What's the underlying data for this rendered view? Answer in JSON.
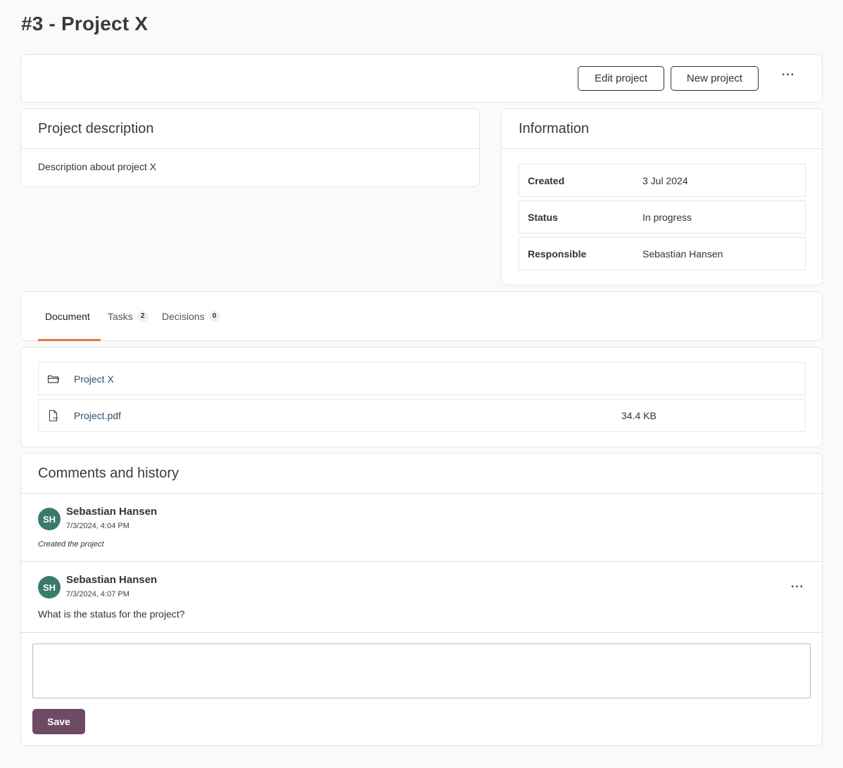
{
  "page": {
    "title": "#3 - Project X"
  },
  "toolbar": {
    "edit_label": "Edit project",
    "new_label": "New project",
    "more_label": "···"
  },
  "description": {
    "title": "Project description",
    "text": "Description about project X"
  },
  "information": {
    "title": "Information",
    "rows": [
      {
        "label": "Created",
        "value": "3 Jul 2024"
      },
      {
        "label": "Status",
        "value": "In progress"
      },
      {
        "label": "Responsible",
        "value": "Sebastian Hansen"
      }
    ]
  },
  "tabs": [
    {
      "label": "Document",
      "count": null,
      "active": true
    },
    {
      "label": "Tasks",
      "count": "2",
      "active": false
    },
    {
      "label": "Decisions",
      "count": "0",
      "active": false
    }
  ],
  "files": [
    {
      "icon": "folder-icon",
      "name": "Project X",
      "size": ""
    },
    {
      "icon": "pdf-file-icon",
      "name": "Project.pdf",
      "size": "34.4 KB"
    }
  ],
  "comments": {
    "title": "Comments and history",
    "items": [
      {
        "initials": "SH",
        "author": "Sebastian Hansen",
        "time": "7/3/2024, 4:04 PM",
        "note": "Created the project"
      },
      {
        "initials": "SH",
        "author": "Sebastian Hansen",
        "time": "7/3/2024, 4:07 PM",
        "text": "What is the status for the project?",
        "more_label": "···"
      }
    ],
    "input_placeholder": "",
    "save_label": "Save"
  },
  "colors": {
    "accent_underline": "#e07b3c",
    "avatar_bg": "#3a7a6c",
    "save_button_bg": "#6e4a64",
    "link": "#2b4f6e"
  }
}
